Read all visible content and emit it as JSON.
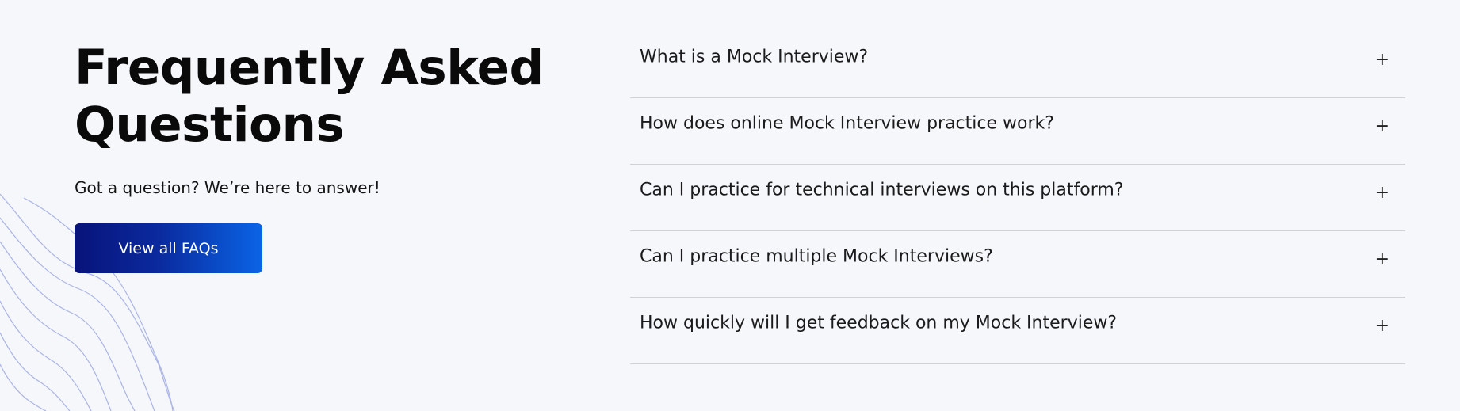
{
  "header": {
    "title_line1": "Frequently Asked",
    "title_line2": "Questions",
    "subtitle": "Got a question? We’re here to answer!",
    "cta_label": "View all FAQs"
  },
  "faq": {
    "items": [
      {
        "question": "What is a Mock Interview?",
        "icon": "plus-icon",
        "icon_glyph": "+"
      },
      {
        "question": "How does online Mock Interview practice work?",
        "icon": "plus-icon",
        "icon_glyph": "+"
      },
      {
        "question": "Can I practice for technical interviews on this platform?",
        "icon": "plus-icon",
        "icon_glyph": "+"
      },
      {
        "question": "Can I practice multiple Mock Interviews?",
        "icon": "plus-icon",
        "icon_glyph": "+"
      },
      {
        "question": "How quickly will I get feedback on my Mock Interview?",
        "icon": "plus-icon",
        "icon_glyph": "+"
      }
    ]
  },
  "colors": {
    "background": "#f6f7fb",
    "button_gradient_start": "#08137a",
    "button_gradient_end": "#0a64e6",
    "divider": "#cfd2d8",
    "decorative_lines": "#aab4e6"
  }
}
